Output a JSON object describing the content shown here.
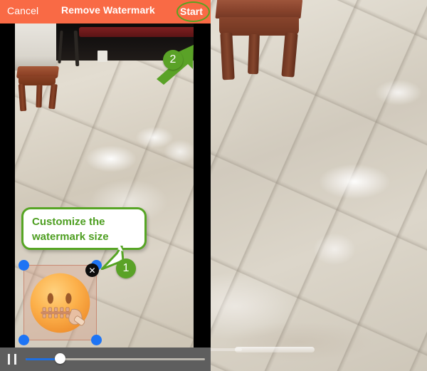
{
  "app": {
    "title": "Remove Watermark",
    "cancel_label": "Cancel",
    "start_label": "Start",
    "accent_color": "#f96a45",
    "highlight_color": "#5aa227"
  },
  "callout": {
    "text": "Customize the\nwatermark size"
  },
  "steps": [
    {
      "number": "1",
      "target": "watermark-selection"
    },
    {
      "number": "2",
      "target": "start-button"
    }
  ],
  "watermark": {
    "emoji_name": "zipper-mouth-face-emoji",
    "emoji_glyph": "🤐",
    "close_label": "✕",
    "handle_color": "#1d74f5",
    "handles": [
      "top-left",
      "top-right",
      "bottom-left",
      "bottom-right"
    ]
  },
  "player": {
    "state_icon": "pause-icon",
    "progress_percent": 18,
    "track_color": "#b9b5ad",
    "fill_color": "#1f6fe0",
    "bar_color": "#5e5e5e"
  },
  "background": {
    "scene": "marble-tile-floor-with-wooden-stool"
  }
}
